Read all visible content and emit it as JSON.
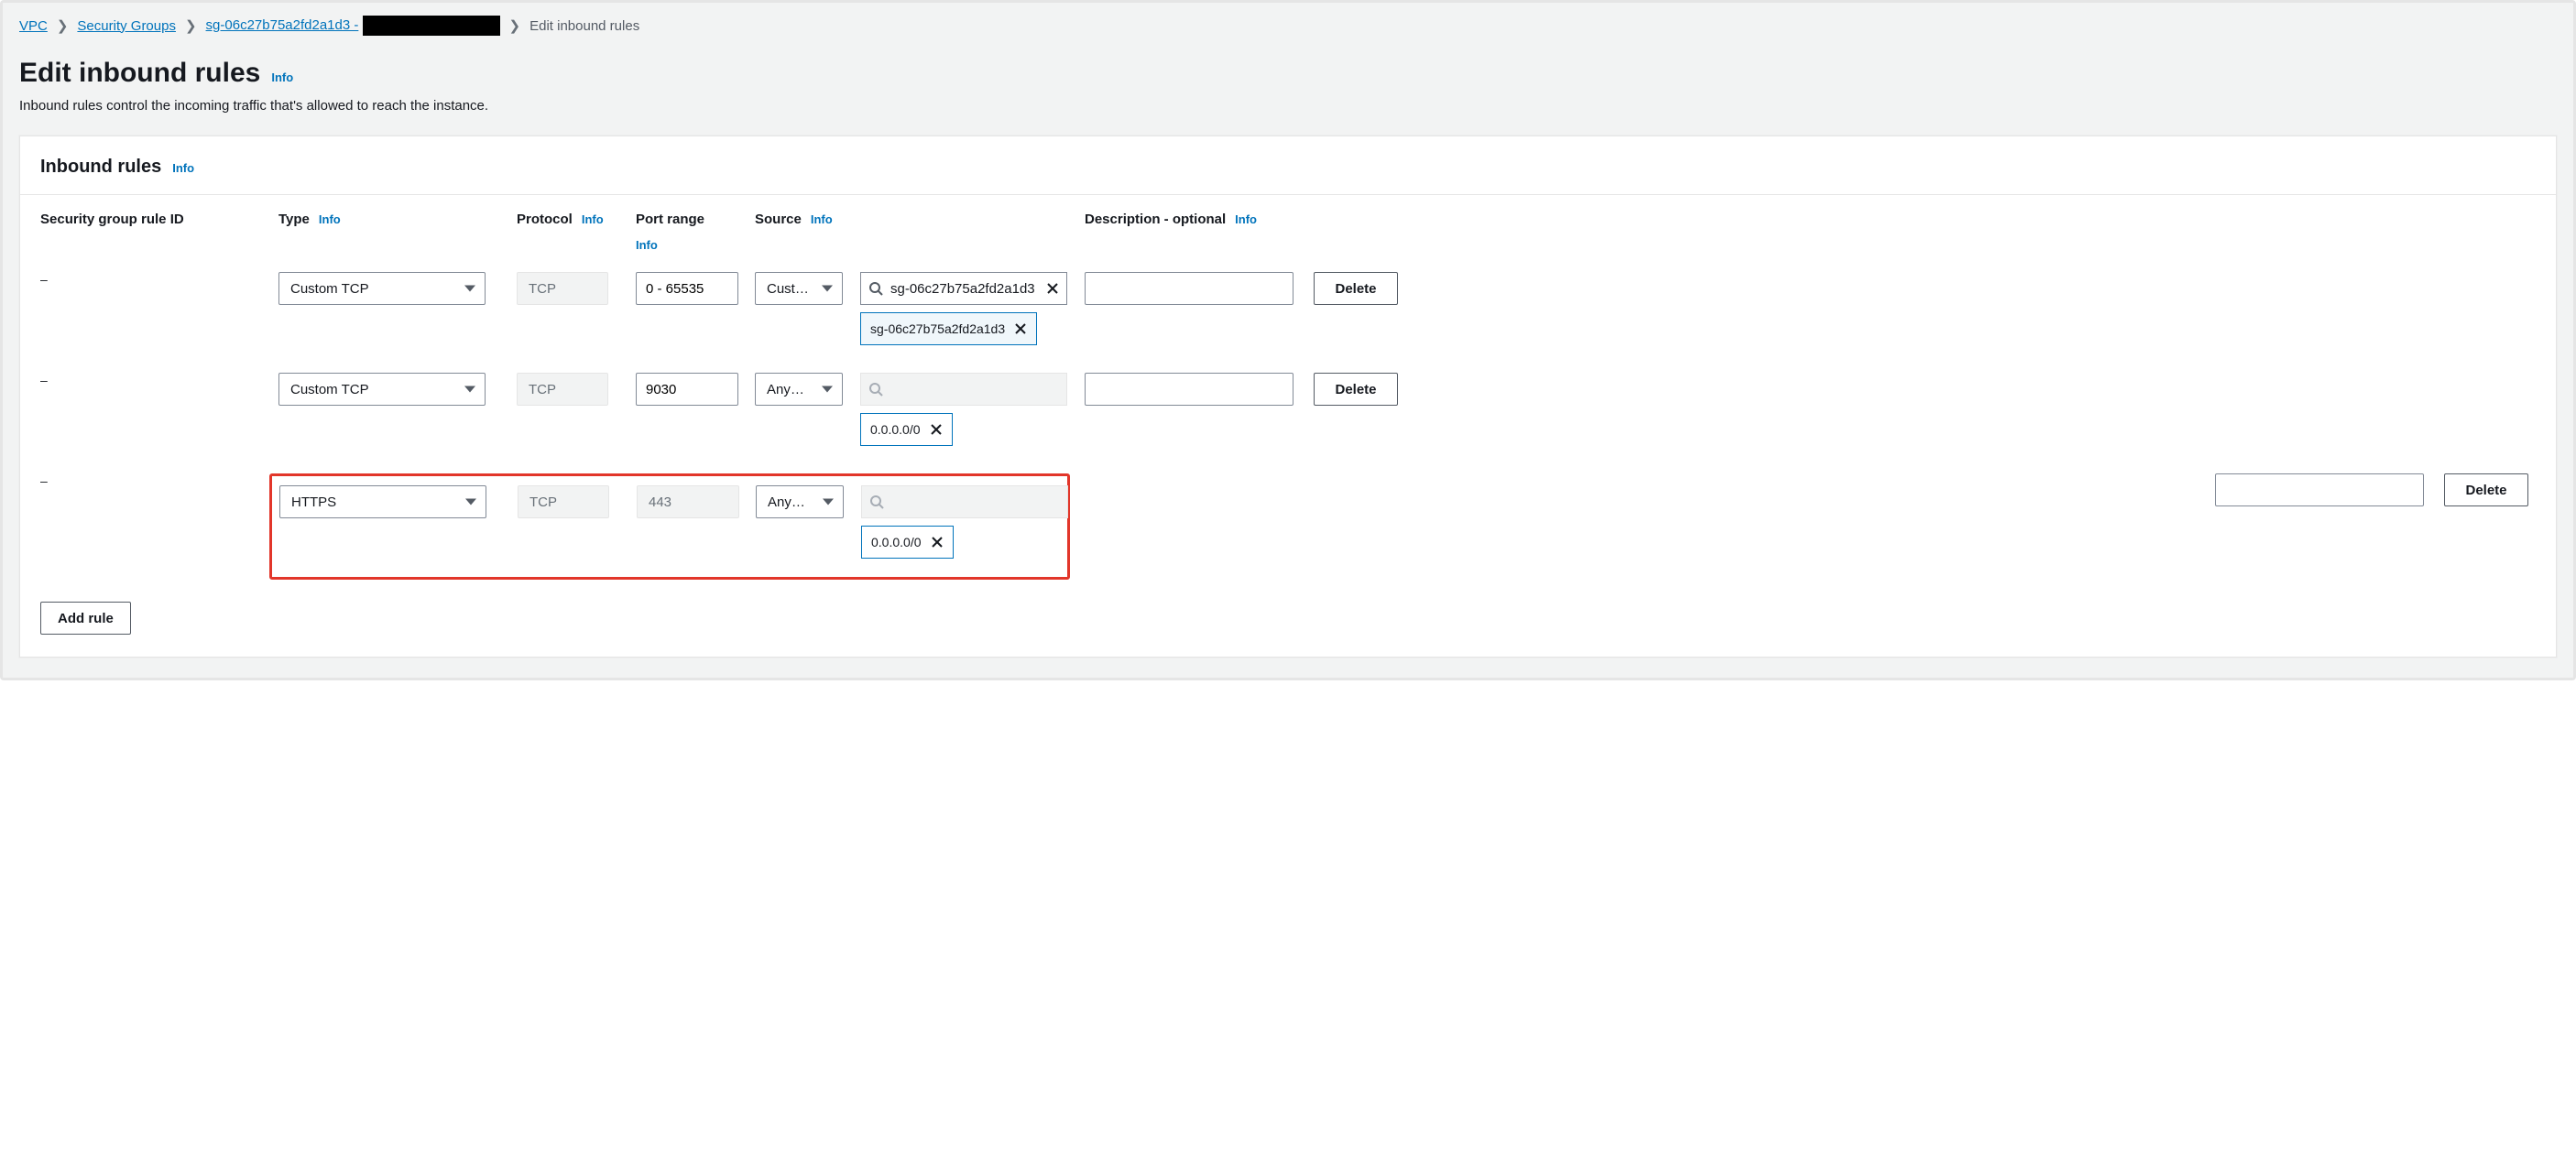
{
  "breadcrumb": {
    "vpc": "VPC",
    "sg_list": "Security Groups",
    "sg_id_prefix": "sg-06c27b75a2fd2a1d3 -",
    "current": "Edit inbound rules"
  },
  "heading": {
    "title": "Edit inbound rules",
    "info": "Info",
    "subtitle": "Inbound rules control the incoming traffic that's allowed to reach the instance."
  },
  "panel": {
    "title": "Inbound rules",
    "info": "Info"
  },
  "columns": {
    "rule_id": "Security group rule ID",
    "type": "Type",
    "protocol": "Protocol",
    "port_range": "Port range",
    "source": "Source",
    "description": "Description - optional",
    "info": "Info"
  },
  "rules": [
    {
      "id": "–",
      "type": "Custom TCP",
      "protocol": "TCP",
      "port_range": "0 - 65535",
      "source_mode": "Custom",
      "source_search": "sg-06c27b75a2fd2a1d3",
      "source_tags": [
        "sg-06c27b75a2fd2a1d3"
      ],
      "description": "",
      "delete": "Delete",
      "protocol_editable": false,
      "port_editable": true,
      "search_enabled": true,
      "highlight": false
    },
    {
      "id": "–",
      "type": "Custom TCP",
      "protocol": "TCP",
      "port_range": "9030",
      "source_mode": "Anyw…",
      "source_search": "",
      "source_tags": [
        "0.0.0.0/0"
      ],
      "description": "",
      "delete": "Delete",
      "protocol_editable": false,
      "port_editable": true,
      "search_enabled": false,
      "highlight": false
    },
    {
      "id": "–",
      "type": "HTTPS",
      "protocol": "TCP",
      "port_range": "443",
      "source_mode": "Anyw…",
      "source_search": "",
      "source_tags": [
        "0.0.0.0/0"
      ],
      "description": "",
      "delete": "Delete",
      "protocol_editable": false,
      "port_editable": false,
      "search_enabled": false,
      "highlight": true
    }
  ],
  "buttons": {
    "add_rule": "Add rule"
  }
}
